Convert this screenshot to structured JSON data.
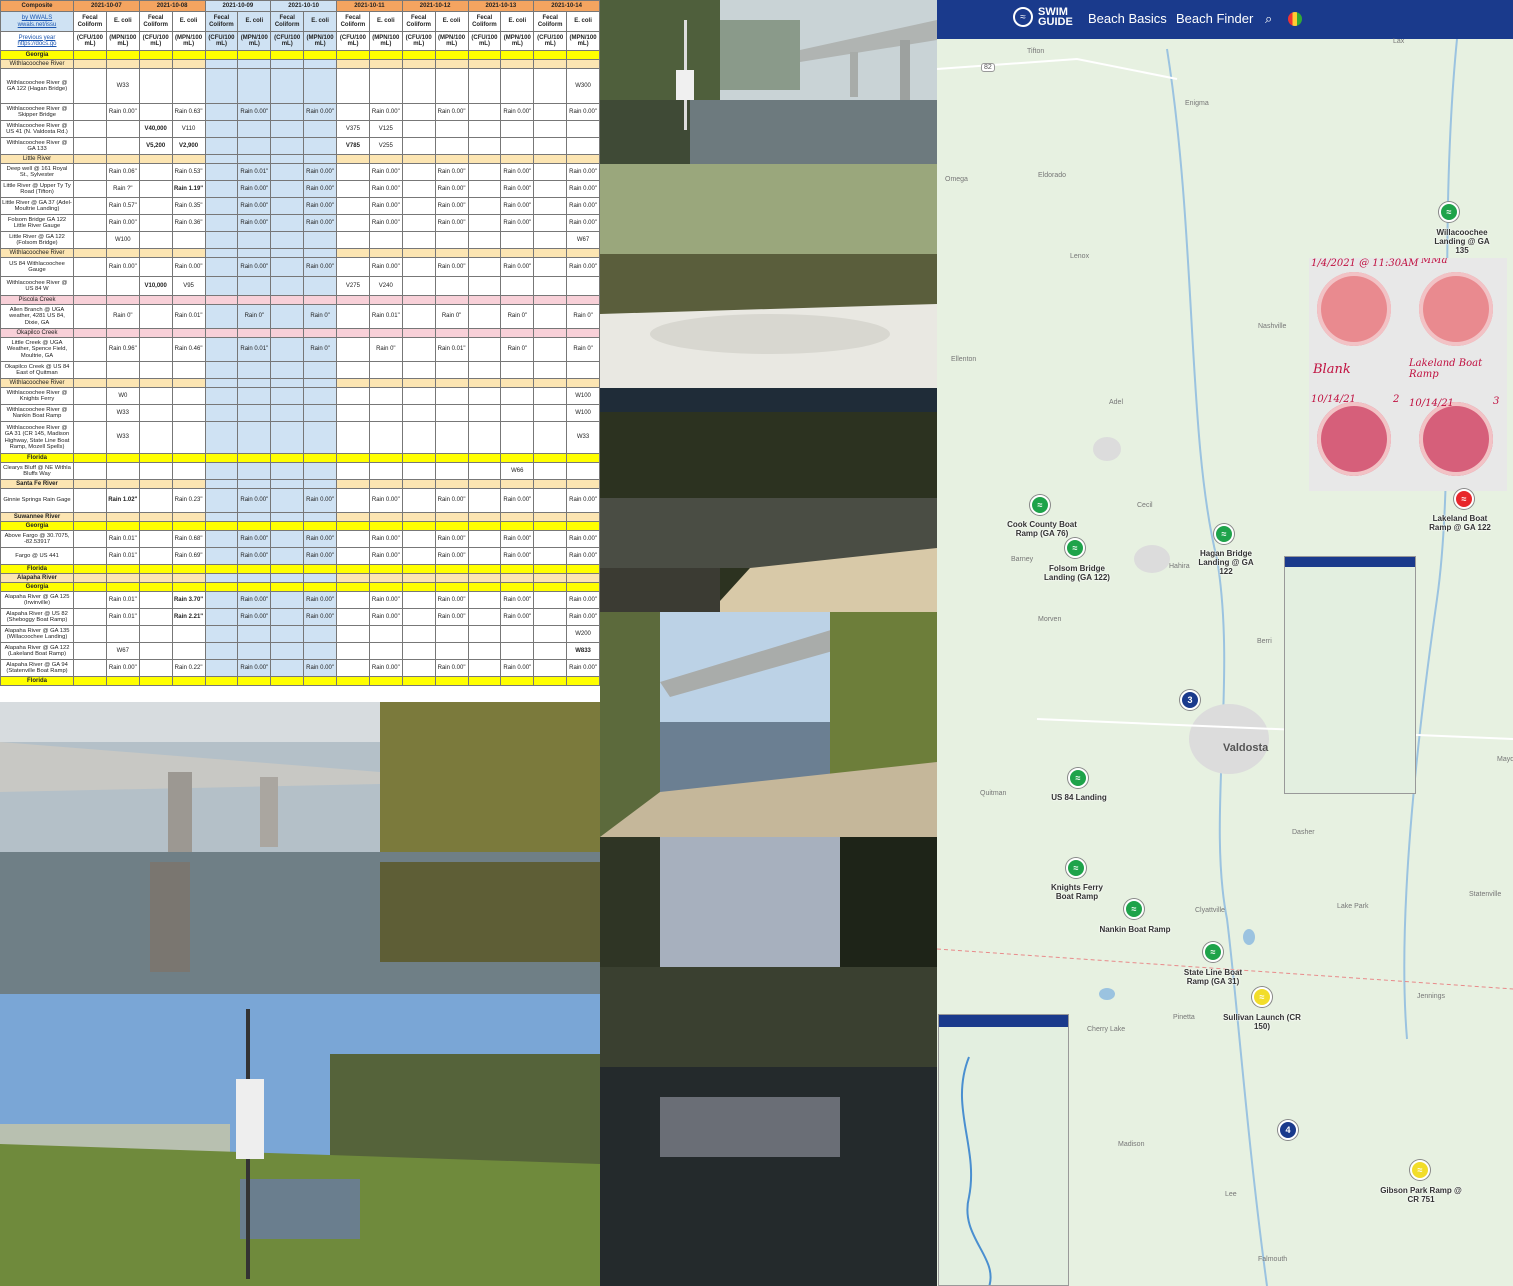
{
  "spreadsheet": {
    "corner": "Composite",
    "link1": "by WWALS wwals.net/issu",
    "link2": "Previous year https://docs.go",
    "dates": [
      "2021-10-07",
      "2021-10-08",
      "2021-10-09",
      "2021-10-10",
      "2021-10-11",
      "2021-10-12",
      "2021-10-13",
      "2021-10-14"
    ],
    "col_a": "Fecal Coliform",
    "col_b": "E. coli",
    "unit_a": "(CFU/100 mL)",
    "unit_b": "(MPN/100 mL)"
  },
  "rows": [
    {
      "t": "state",
      "label": "Georgia"
    },
    {
      "t": "river",
      "label": "Withlacoochee River"
    },
    {
      "t": "site",
      "label": "Withlacoochee River @ GA 122 (Hagan Bridge)",
      "h": 35,
      "c": {
        "1": [
          "W33",
          "g"
        ],
        "15": [
          "W300",
          "o"
        ]
      }
    },
    {
      "t": "site",
      "label": "Withlacoochee River @ Skipper Bridge",
      "h": 17,
      "c": {
        "1": [
          "Rain 0.00\"",
          ""
        ],
        "3": [
          "Rain 0.63\"",
          "r"
        ],
        "5": [
          "Rain 0.00\"",
          ""
        ],
        "7": [
          "Rain 0.00\"",
          ""
        ],
        "9": [
          "Rain 0.00\"",
          ""
        ],
        "11": [
          "Rain 0.00\"",
          ""
        ],
        "13": [
          "Rain 0.00\"",
          ""
        ],
        "15": [
          "Rain 0.00\"",
          ""
        ]
      }
    },
    {
      "t": "site",
      "label": "Withlacoochee River @ US 41 (N. Valdosta Rd.)",
      "h": 17,
      "c": {
        "2": [
          "V40,000",
          "m"
        ],
        "3": [
          "V110",
          "g"
        ],
        "8": [
          "V375",
          "o"
        ],
        "9": [
          "V125",
          "g"
        ]
      }
    },
    {
      "t": "site",
      "label": "Withlacoochee River @ GA 133",
      "h": 17,
      "c": {
        "2": [
          "V5,200",
          "m"
        ],
        "3": [
          "V2,900",
          "m"
        ],
        "8": [
          "V785",
          "rb"
        ],
        "9": [
          "V255",
          "o"
        ]
      }
    },
    {
      "t": "river",
      "label": "Little River"
    },
    {
      "t": "site",
      "label": "Deep well @ 161 Royal St., Sylvester",
      "h": 17,
      "c": {
        "1": [
          "Rain 0.06\"",
          ""
        ],
        "3": [
          "Rain 0.53\"",
          "r"
        ],
        "5": [
          "Rain 0.01\"",
          ""
        ],
        "7": [
          "Rain 0.00\"",
          ""
        ],
        "9": [
          "Rain 0.00\"",
          ""
        ],
        "11": [
          "Rain 0.00\"",
          ""
        ],
        "13": [
          "Rain 0.00\"",
          ""
        ],
        "15": [
          "Rain 0.00\"",
          ""
        ]
      }
    },
    {
      "t": "site",
      "label": "Little River @ Upper Ty Ty Road (Tifton)",
      "h": 17,
      "c": {
        "1": [
          "Rain ?\"",
          ""
        ],
        "3": [
          "Rain 1.19\"",
          "m"
        ],
        "5": [
          "Rain 0.00\"",
          ""
        ],
        "7": [
          "Rain 0.00\"",
          ""
        ],
        "9": [
          "Rain 0.00\"",
          ""
        ],
        "11": [
          "Rain 0.00\"",
          ""
        ],
        "13": [
          "Rain 0.00\"",
          ""
        ],
        "15": [
          "Rain 0.00\"",
          ""
        ]
      }
    },
    {
      "t": "site",
      "label": "Little River @ GA 37 (Adel-Moultrie Landing)",
      "h": 17,
      "c": {
        "1": [
          "Rain 0.57\"",
          "r"
        ],
        "3": [
          "Rain 0.35\"",
          ""
        ],
        "5": [
          "Rain 0.00\"",
          ""
        ],
        "7": [
          "Rain 0.00\"",
          ""
        ],
        "9": [
          "Rain 0.00\"",
          ""
        ],
        "11": [
          "Rain 0.00\"",
          ""
        ],
        "13": [
          "Rain 0.00\"",
          ""
        ],
        "15": [
          "Rain 0.00\"",
          ""
        ]
      }
    },
    {
      "t": "site",
      "label": "Folsom Bridge GA 122 Little River Gauge",
      "h": 17,
      "c": {
        "1": [
          "Rain 0.00\"",
          ""
        ],
        "3": [
          "Rain 0.36\"",
          ""
        ],
        "5": [
          "Rain 0.00\"",
          ""
        ],
        "7": [
          "Rain 0.00\"",
          ""
        ],
        "9": [
          "Rain 0.00\"",
          ""
        ],
        "11": [
          "Rain 0.00\"",
          ""
        ],
        "13": [
          "Rain 0.00\"",
          ""
        ],
        "15": [
          "Rain 0.00\"",
          ""
        ]
      }
    },
    {
      "t": "site",
      "label": "Little River @ GA 122 (Folsom Bridge)",
      "h": 17,
      "c": {
        "1": [
          "W100",
          "g"
        ],
        "15": [
          "W67",
          "g"
        ]
      }
    },
    {
      "t": "river",
      "label": "Withlacoochee River"
    },
    {
      "t": "site",
      "label": "US 84 Withlacoochee Gauge",
      "h": 19,
      "c": {
        "1": [
          "Rain 0.00\"",
          ""
        ],
        "3": [
          "Rain 0.00\"",
          ""
        ],
        "5": [
          "Rain 0.00\"",
          ""
        ],
        "7": [
          "Rain 0.00\"",
          ""
        ],
        "9": [
          "Rain 0.00\"",
          ""
        ],
        "11": [
          "Rain 0.00\"",
          ""
        ],
        "13": [
          "Rain 0.00\"",
          ""
        ],
        "15": [
          "Rain 0.00\"",
          ""
        ]
      }
    },
    {
      "t": "site",
      "label": "Withlacoochee River @ US 84 W",
      "h": 19,
      "c": {
        "2": [
          "V10,000",
          "m"
        ],
        "3": [
          "V95",
          "g"
        ],
        "8": [
          "V275",
          "g"
        ],
        "9": [
          "V240",
          "g"
        ]
      }
    },
    {
      "t": "pink",
      "label": "Piscola Creek"
    },
    {
      "t": "site",
      "label": "Allen Branch @ UGA weather, 4281 US 84, Dixie, GA",
      "h": 24,
      "c": {
        "1": [
          "Rain 0\"",
          ""
        ],
        "3": [
          "Rain 0.01\"",
          ""
        ],
        "5": [
          "Rain 0\"",
          ""
        ],
        "7": [
          "Rain 0\"",
          ""
        ],
        "9": [
          "Rain 0.01\"",
          ""
        ],
        "11": [
          "Rain 0\"",
          ""
        ],
        "13": [
          "Rain 0\"",
          ""
        ],
        "15": [
          "Rain 0\"",
          ""
        ]
      }
    },
    {
      "t": "pink",
      "label": "Okapilco Creek"
    },
    {
      "t": "site",
      "label": "Little Creek @ UGA Weather, Spence Field, Moultrie, GA",
      "h": 24,
      "c": {
        "1": [
          "Rain 0.96\"",
          "r"
        ],
        "3": [
          "Rain 0.46\"",
          ""
        ],
        "5": [
          "Rain 0.01\"",
          ""
        ],
        "7": [
          "Rain 0\"",
          ""
        ],
        "9": [
          "Rain 0\"",
          ""
        ],
        "11": [
          "Rain 0.01\"",
          ""
        ],
        "13": [
          "Rain 0\"",
          ""
        ],
        "15": [
          "Rain 0\"",
          ""
        ]
      }
    },
    {
      "t": "site",
      "label": "Okapilco Creek @ US 84 East of Quitman",
      "h": 17,
      "c": {}
    },
    {
      "t": "river",
      "label": "Withlacoochee River"
    },
    {
      "t": "site",
      "label": "Withlacoochee River @ Knights Ferry",
      "h": 17,
      "c": {
        "1": [
          "W0",
          "g"
        ],
        "15": [
          "W100",
          "g"
        ]
      }
    },
    {
      "t": "site",
      "label": "Withlacoochee River @ Nankin Boat Ramp",
      "h": 17,
      "c": {
        "1": [
          "W33",
          "g"
        ],
        "15": [
          "W100",
          "g"
        ]
      }
    },
    {
      "t": "site",
      "label": "Withlacoochee River @ GA 31 (CR 145, Madison Highway, State Line Boat Ramp, Mozell Spells)",
      "h": 32,
      "c": {
        "1": [
          "W33",
          "g"
        ],
        "15": [
          "W33",
          "g"
        ]
      }
    },
    {
      "t": "state",
      "label": "Florida"
    },
    {
      "t": "site",
      "label": "Clearys Bluff @ NE Withla Bluffs Way",
      "h": 17,
      "c": {
        "13": [
          "W66",
          "g"
        ]
      }
    },
    {
      "t": "state2",
      "label": "Santa Fe River"
    },
    {
      "t": "site",
      "label": "Ginnie Springs Rain Gage",
      "h": 24,
      "c": {
        "1": [
          "Rain 1.02\"",
          "m"
        ],
        "3": [
          "Rain 0.23\"",
          ""
        ],
        "5": [
          "Rain 0.00\"",
          ""
        ],
        "7": [
          "Rain 0.00\"",
          ""
        ],
        "9": [
          "Rain 0.00\"",
          ""
        ],
        "11": [
          "Rain 0.00\"",
          ""
        ],
        "13": [
          "Rain 0.00\"",
          ""
        ],
        "15": [
          "Rain 0.00\"",
          ""
        ]
      }
    },
    {
      "t": "state2",
      "label": "Suwannee River"
    },
    {
      "t": "state",
      "label": "Georgia"
    },
    {
      "t": "site",
      "label": "Above Fargo @ 30.7075, -82.53917",
      "h": 17,
      "c": {
        "1": [
          "Rain 0.01\"",
          ""
        ],
        "3": [
          "Rain 0.68\"",
          "r"
        ],
        "5": [
          "Rain 0.00\"",
          ""
        ],
        "7": [
          "Rain 0.00\"",
          ""
        ],
        "9": [
          "Rain 0.00\"",
          ""
        ],
        "11": [
          "Rain 0.00\"",
          ""
        ],
        "13": [
          "Rain 0.00\"",
          ""
        ],
        "15": [
          "Rain 0.00\"",
          ""
        ]
      }
    },
    {
      "t": "site",
      "label": "Fargo @ US 441",
      "h": 17,
      "c": {
        "1": [
          "Rain 0.01\"",
          ""
        ],
        "3": [
          "Rain 0.69\"",
          "r"
        ],
        "5": [
          "Rain 0.00\"",
          ""
        ],
        "7": [
          "Rain 0.00\"",
          ""
        ],
        "9": [
          "Rain 0.00\"",
          ""
        ],
        "11": [
          "Rain 0.00\"",
          ""
        ],
        "13": [
          "Rain 0.00\"",
          ""
        ],
        "15": [
          "Rain 0.00\"",
          ""
        ]
      }
    },
    {
      "t": "state",
      "label": "Florida"
    },
    {
      "t": "state2",
      "label": "Alapaha River"
    },
    {
      "t": "state",
      "label": "Georgia"
    },
    {
      "t": "site",
      "label": "Alapaha River @ GA 125 (Irwinville)",
      "h": 17,
      "c": {
        "1": [
          "Rain 0.01\"",
          ""
        ],
        "3": [
          "Rain 3.70\"",
          "m"
        ],
        "5": [
          "Rain 0.00\"",
          ""
        ],
        "7": [
          "Rain 0.00\"",
          ""
        ],
        "9": [
          "Rain 0.00\"",
          ""
        ],
        "11": [
          "Rain 0.00\"",
          ""
        ],
        "13": [
          "Rain 0.00\"",
          ""
        ],
        "15": [
          "Rain 0.00\"",
          ""
        ]
      }
    },
    {
      "t": "site",
      "label": "Alapaha River @ US 82 (Sheboggy Boat Ramp)",
      "h": 17,
      "c": {
        "1": [
          "Rain 0.01\"",
          ""
        ],
        "3": [
          "Rain 2.21\"",
          "m"
        ],
        "5": [
          "Rain 0.00\"",
          ""
        ],
        "7": [
          "Rain 0.00\"",
          ""
        ],
        "9": [
          "Rain 0.00\"",
          ""
        ],
        "11": [
          "Rain 0.00\"",
          ""
        ],
        "13": [
          "Rain 0.00\"",
          ""
        ],
        "15": [
          "Rain 0.00\"",
          ""
        ]
      }
    },
    {
      "t": "site",
      "label": "Alapaha River @ GA 135 (Willacoochee Landing)",
      "h": 17,
      "c": {
        "15": [
          "W200",
          "g"
        ]
      }
    },
    {
      "t": "site",
      "label": "Alapaha River @ GA 122 (Lakeland Boat Ramp)",
      "h": 17,
      "c": {
        "1": [
          "W67",
          "g"
        ],
        "15": [
          "W833",
          "rb"
        ]
      }
    },
    {
      "t": "site",
      "label": "Alapaha River @ GA 94 (Statenville Boat Ramp)",
      "h": 17,
      "c": {
        "1": [
          "Rain 0.00\"",
          ""
        ],
        "3": [
          "Rain 0.22\"",
          ""
        ],
        "5": [
          "Rain 0.00\"",
          ""
        ],
        "7": [
          "Rain 0.00\"",
          ""
        ],
        "9": [
          "Rain 0.00\"",
          ""
        ],
        "11": [
          "Rain 0.00\"",
          ""
        ],
        "13": [
          "Rain 0.00\"",
          ""
        ],
        "15": [
          "Rain 0.00\"",
          ""
        ]
      }
    },
    {
      "t": "state",
      "label": "Florida"
    }
  ],
  "map": {
    "nav": {
      "logo_line1": "SWIM",
      "logo_line2": "GUIDE",
      "beach_basics": "Beach Basics",
      "beach_finder": "Beach Finder"
    },
    "city": "Valdosta",
    "towns": [
      {
        "name": "Tifton"
      },
      {
        "name": "Enigma"
      },
      {
        "name": "Omega"
      },
      {
        "name": "Eldorado"
      },
      {
        "name": "Lenox"
      },
      {
        "name": "Nashville"
      },
      {
        "name": "Ellenton"
      },
      {
        "name": "Adel"
      },
      {
        "name": "Cecil"
      },
      {
        "name": "Barney"
      },
      {
        "name": "Hahira"
      },
      {
        "name": "Morven"
      },
      {
        "name": "Quitman"
      },
      {
        "name": "Dasher"
      },
      {
        "name": "Clyattville"
      },
      {
        "name": "Lake Park"
      },
      {
        "name": "Statenville"
      },
      {
        "name": "Pinetta"
      },
      {
        "name": "Cherry Lake"
      },
      {
        "name": "Jennings"
      },
      {
        "name": "Madison"
      },
      {
        "name": "Lee"
      },
      {
        "name": "Falmouth"
      },
      {
        "name": "Mayday"
      },
      {
        "name": "Lax"
      },
      {
        "name": "Berri"
      }
    ],
    "highway": "82",
    "pins": [
      {
        "label": "Willacoochee Landing @ GA 135",
        "color": "green"
      },
      {
        "label": "Cook County Boat Ramp (GA 76)",
        "color": "green"
      },
      {
        "label": "Folsom Bridge Landing (GA 122)",
        "color": "green"
      },
      {
        "label": "Hagan Bridge Landing @ GA 122",
        "color": "green"
      },
      {
        "label": "Lakeland Boat Ramp @ GA 122",
        "color": "red"
      },
      {
        "label": "US 84 Landing",
        "color": "green"
      },
      {
        "label": "Knights Ferry Boat Ramp",
        "color": "green"
      },
      {
        "label": "Nankin Boat Ramp",
        "color": "green"
      },
      {
        "label": "State Line Boat Ramp (GA 31)",
        "color": "green"
      },
      {
        "label": "Sullivan Launch (CR 150)",
        "color": "yellow"
      },
      {
        "label": "Gibson Park Ramp @ CR 751",
        "color": "yellow"
      }
    ],
    "clusters": [
      "3",
      "4"
    ],
    "plates": {
      "top_left": "1/4/2021 @ 11:30AM",
      "top_right": "MMa",
      "mid_left": "Blank",
      "mid_right": "Lakeland Boat Ramp",
      "bottom_left": "10/14/21",
      "bottom_left_num": "2",
      "bottom_right": "10/14/21",
      "bottom_right_num": "3"
    }
  }
}
